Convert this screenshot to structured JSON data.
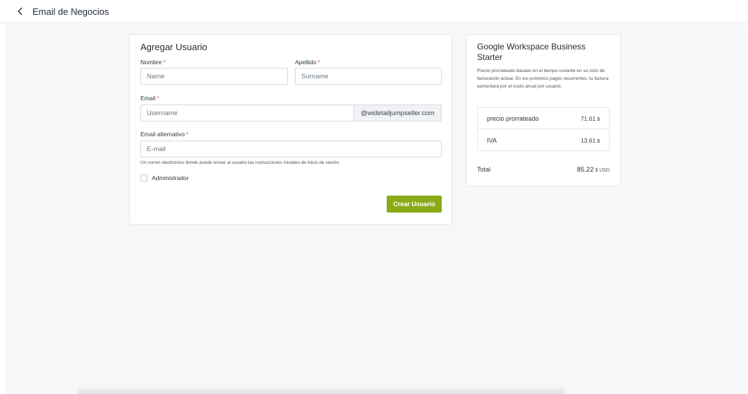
{
  "header": {
    "title": "Email de Negocios",
    "back_icon": "chevron-left-icon"
  },
  "form": {
    "title": "Agregar Usuario",
    "first_name": {
      "label": "Nombre",
      "placeholder": "Name",
      "value": ""
    },
    "last_name": {
      "label": "Apellido",
      "placeholder": "Surname",
      "value": ""
    },
    "email": {
      "label": "Email",
      "placeholder": "Username",
      "value": "",
      "domain": "@widetailjumpseller.com"
    },
    "alt_email": {
      "label": "Email alternativo",
      "placeholder": "E-mail",
      "value": "",
      "help": "Un correo electrónico donde puede enviar al usuario las instrucciones iniciales de inicio de sesión."
    },
    "required_marker": "*",
    "admin_checkbox": {
      "label": "Administrador",
      "checked": false
    },
    "submit_label": "Crear Usuario",
    "accent_color": "#8aab17"
  },
  "summary": {
    "title": "Google Workspace Business Starter",
    "description": "Precio prorrateado basado en el tiempo restante en su ciclo de facturación actual. En tus próximos pagos recurrentes, tu factura aumentará por el costo anual por usuario.",
    "rows": [
      {
        "label": "precio prorrateado",
        "value": "71.61",
        "currency": "$"
      },
      {
        "label": "IVA",
        "value": "13.61",
        "currency": "$"
      }
    ],
    "total": {
      "label": "Total",
      "value": "85.22",
      "currency": "$ USD"
    }
  }
}
